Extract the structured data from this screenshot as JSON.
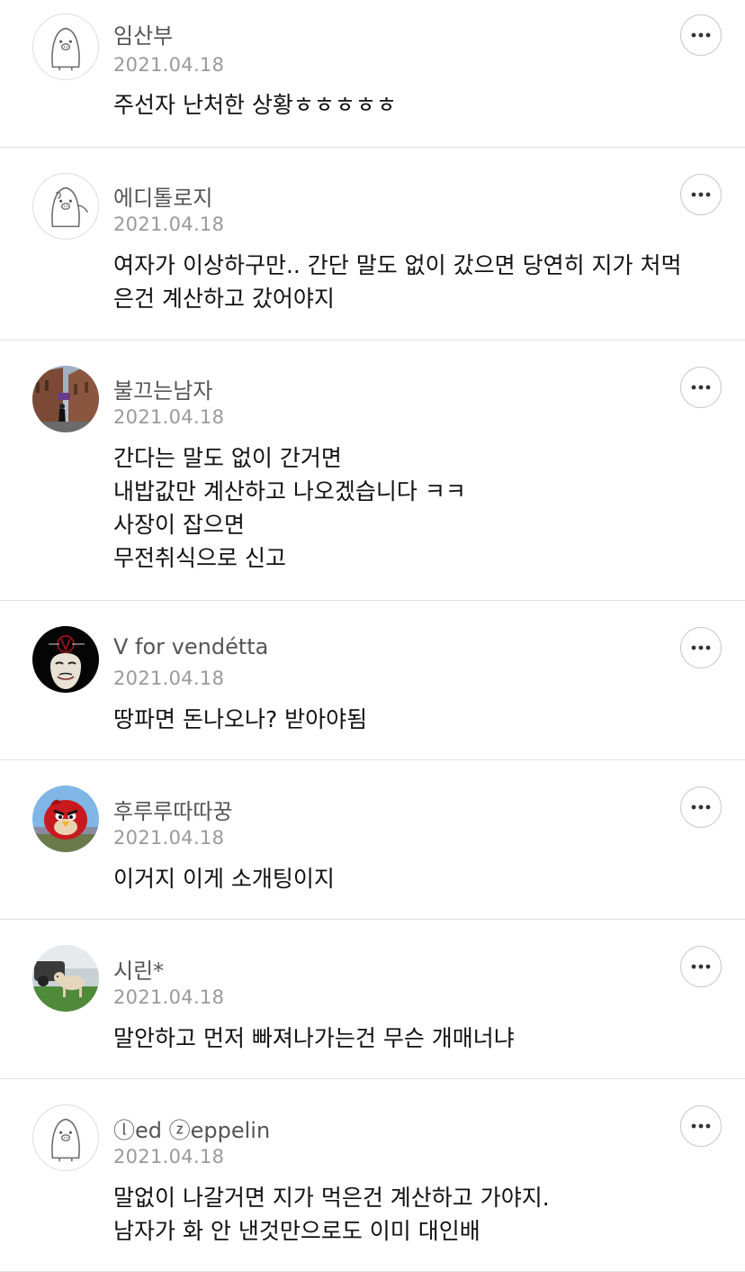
{
  "comments": [
    {
      "nickname": "임산부",
      "date": "2021.04.18",
      "avatar": "default-character-avatar",
      "lines": [
        "주선자 난처한 상황ㅎㅎㅎㅎㅎ"
      ]
    },
    {
      "nickname": "에디톨로지",
      "date": "2021.04.18",
      "avatar": "default-character-avatar-waving",
      "lines": [
        "여자가 이상하구만.. 간단 말도 없이 갔으면 당연히 지가 처먹",
        "은건 계산하고 갔어야지"
      ]
    },
    {
      "nickname": "불끄는남자",
      "date": "2021.04.18",
      "avatar": "photo-brick-building-avatar",
      "lines": [
        "간다는 말도 없이 간거면",
        "내밥값만 계산하고 나오겠습니다 ㅋㅋ",
        "사장이 잡으면",
        "무전취식으로 신고"
      ]
    },
    {
      "nickname": "V for vendétta",
      "date": "2021.04.18",
      "avatar": "photo-mask-avatar",
      "lines": [
        "땅파면 돈나오나? 받아야됨"
      ]
    },
    {
      "nickname": "후루루따따꿍",
      "date": "2021.04.18",
      "avatar": "photo-red-bird-avatar",
      "lines": [
        "이거지 이게 소개팅이지"
      ]
    },
    {
      "nickname": "시린*",
      "date": "2021.04.18",
      "avatar": "photo-dog-avatar",
      "lines": [
        "말안하고 먼저 빠져나가는건 무슨 개매너냐"
      ]
    },
    {
      "nickname": "ⓛed ⓩeppelin",
      "date": "2021.04.18",
      "avatar": "default-character-avatar",
      "lines": [
        "말없이 나갈거면 지가 먹은건 계산하고 가야지.",
        "남자가 화 안 낸것만으로도 이미 대인배"
      ]
    }
  ],
  "more_icon": "more-horizontal-icon"
}
